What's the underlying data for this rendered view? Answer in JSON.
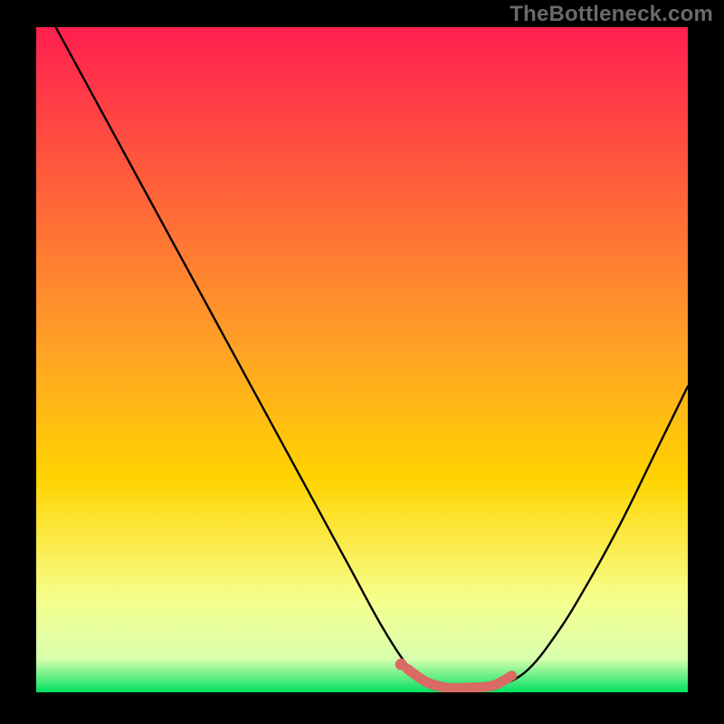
{
  "watermark": "TheBottleneck.com",
  "colors": {
    "background": "#000000",
    "gradient_top": "#ff1f4f",
    "gradient_mid": "#ffd400",
    "gradient_low": "#f6ff8c",
    "gradient_bottom": "#00e060",
    "curve": "#000000",
    "marker_stroke": "#d96a64",
    "marker_fill": "#d96a64"
  },
  "chart_data": {
    "type": "line",
    "title": "",
    "xlabel": "",
    "ylabel": "",
    "xlim": [
      0,
      100
    ],
    "ylim": [
      0,
      100
    ],
    "series": [
      {
        "name": "bottleneck-curve",
        "x": [
          3,
          8,
          13,
          18,
          23,
          28,
          33,
          38,
          43,
          48,
          53,
          57,
          60,
          63,
          66,
          70,
          75,
          80,
          85,
          90,
          95,
          100
        ],
        "y": [
          100,
          91,
          82,
          73,
          64,
          55,
          46,
          37,
          28,
          19,
          10,
          4,
          1.5,
          0.5,
          0.5,
          0.8,
          3,
          9,
          17,
          26,
          36,
          46
        ]
      }
    ],
    "highlight": {
      "name": "optimal-range",
      "x": [
        57,
        60,
        63,
        66,
        70,
        73
      ],
      "y": [
        3.5,
        1.5,
        0.7,
        0.7,
        1.0,
        2.5
      ]
    },
    "marker": {
      "name": "optimal-point",
      "x": 56,
      "y": 4.2
    }
  }
}
